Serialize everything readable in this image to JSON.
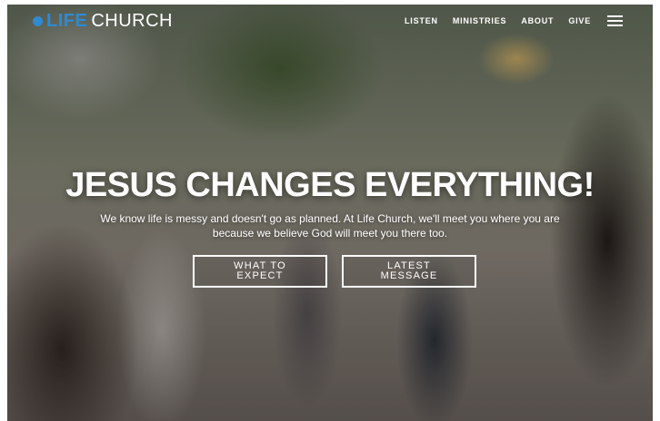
{
  "logo": {
    "part1": "LIFE",
    "part2": "CHURCH"
  },
  "nav": {
    "items": [
      "LISTEN",
      "MINISTRIES",
      "ABOUT",
      "GIVE"
    ]
  },
  "hero": {
    "title": "JESUS CHANGES EVERYTHING!",
    "text": "We know life is messy and doesn't go as planned. At Life Church, we'll meet you where you are because we believe God will meet you there too."
  },
  "buttons": {
    "primary": "WHAT TO EXPECT",
    "secondary": "LATEST MESSAGE"
  },
  "colors": {
    "brand": "#2f8ad0",
    "text": "#ffffff"
  },
  "icons": {
    "menu": "hamburger-menu-icon",
    "logo": "circle-logo-mark"
  }
}
